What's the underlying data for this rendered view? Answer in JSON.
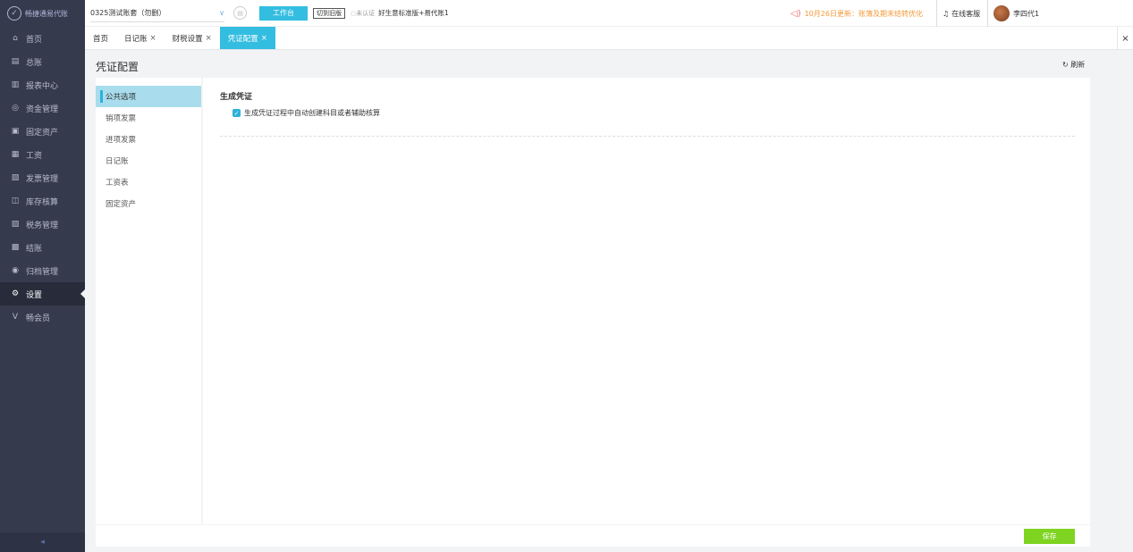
{
  "brand": {
    "name": "畅捷通易代账"
  },
  "sidebar": {
    "items": [
      {
        "icon": "⌂",
        "label": "首页"
      },
      {
        "icon": "▤",
        "label": "总账"
      },
      {
        "icon": "▥",
        "label": "报表中心"
      },
      {
        "icon": "◎",
        "label": "资金管理"
      },
      {
        "icon": "▣",
        "label": "固定资产"
      },
      {
        "icon": "▦",
        "label": "工资"
      },
      {
        "icon": "▧",
        "label": "发票管理"
      },
      {
        "icon": "◫",
        "label": "库存核算"
      },
      {
        "icon": "▨",
        "label": "税务管理"
      },
      {
        "icon": "▩",
        "label": "结账"
      },
      {
        "icon": "◉",
        "label": "归档管理"
      },
      {
        "icon": "⚙",
        "label": "设置"
      },
      {
        "icon": "V",
        "label": "畅会员"
      }
    ],
    "active_index": 11,
    "collapse_icon": "◂"
  },
  "topbar": {
    "account": "0325测试账套（勿删）",
    "work_button": "工作台",
    "switch_button": "切到旧版",
    "cert_status": "未认证",
    "product": "好生意标准版+易代账1",
    "notice": "10月26日更新：账簿及期末结转优化",
    "service": "在线客服",
    "user": "李四代1"
  },
  "tabs": [
    {
      "label": "首页",
      "closable": false
    },
    {
      "label": "日记账",
      "closable": true
    },
    {
      "label": "财税设置",
      "closable": true
    },
    {
      "label": "凭证配置",
      "closable": true,
      "active": true
    }
  ],
  "tab_close_all": "×",
  "page": {
    "title": "凭证配置",
    "refresh": "刷新"
  },
  "subnav": [
    "公共选项",
    "销项发票",
    "进项发票",
    "日记账",
    "工资表",
    "固定资产"
  ],
  "content": {
    "section_title": "生成凭证",
    "checkbox_label": "生成凭证过程中自动创建科目或者辅助核算",
    "checkbox_checked": true
  },
  "footer": {
    "save_label": "保存"
  },
  "colors": {
    "accent": "#33bde0",
    "sidebar": "#353a4d",
    "save": "#7fd321",
    "notice": "#f39a3a"
  }
}
